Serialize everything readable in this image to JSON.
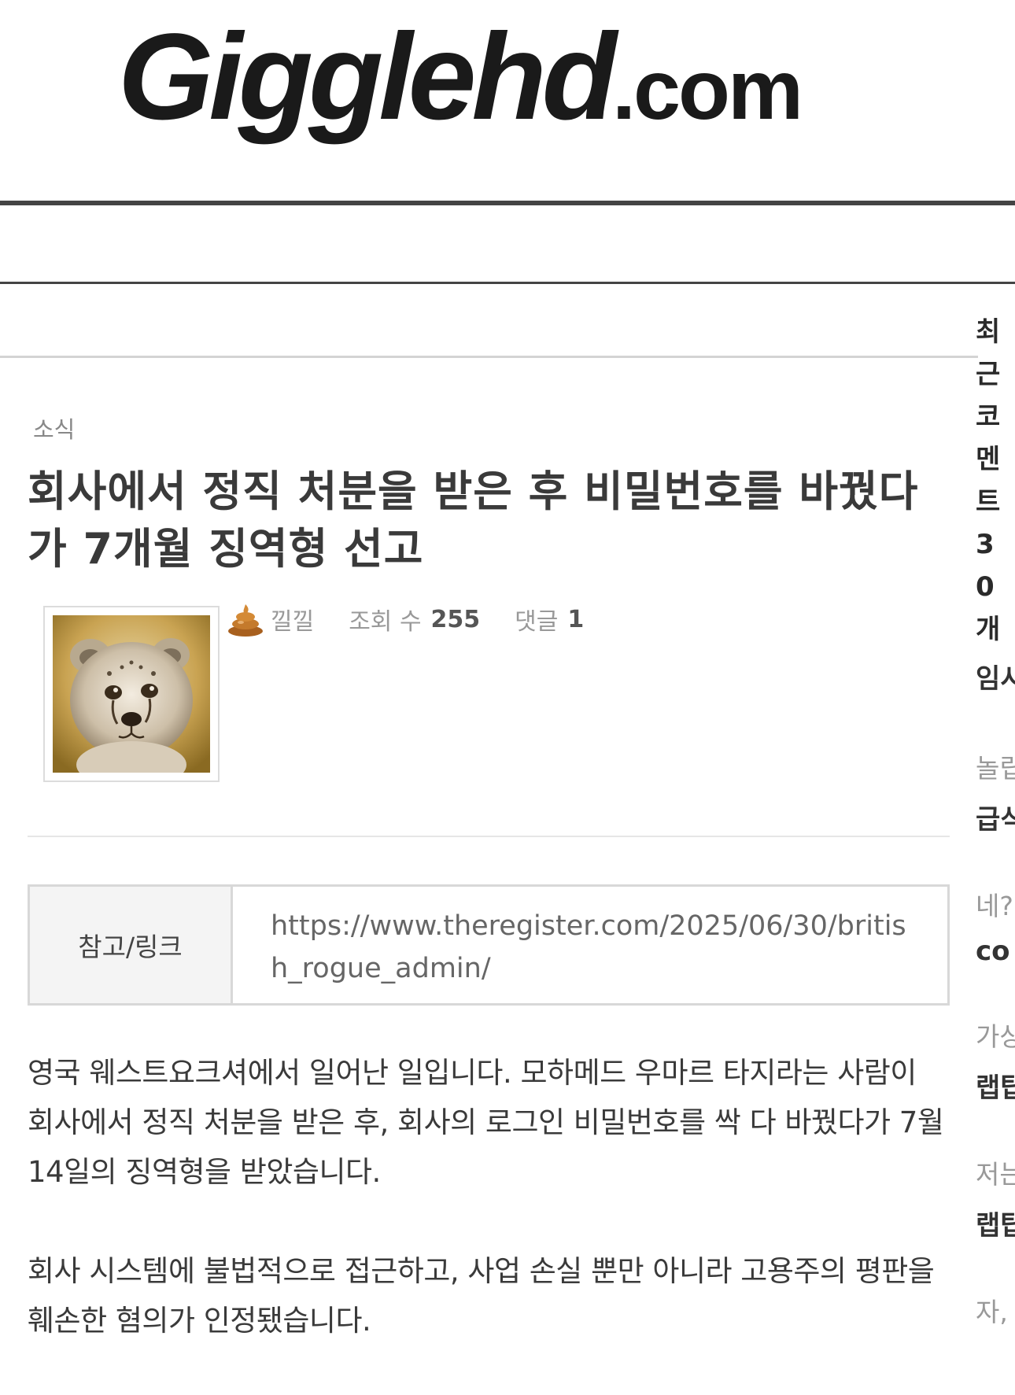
{
  "site": {
    "logo_main": "Gigglehd",
    "logo_tld": ".com"
  },
  "post": {
    "category": "소식",
    "title": "회사에서 정직 처분을 받은 후 비밀번호를 바꿨다가 7개월 징역형 선고",
    "author": "낄낄",
    "views_label": "조회 수",
    "views_value": "255",
    "comments_label": "댓글",
    "comments_value": "1",
    "ref_label": "참고/링크",
    "ref_url": "https://www.theregister.com/2025/06/30/british_rogue_admin/",
    "body": [
      "영국 웨스트요크셔에서 일어난 일입니다. 모하메드 우마르 타지라는 사람이 회사에서 정직 처분을 받은 후, 회사의 로그인 비밀번호를 싹 다 바꿨다가 7월 14일의 징역형을 받았습니다.",
      "회사 시스템에 불법적으로 접근하고, 사업 손실 뿐만 아니라 고용주의 평판을 훼손한 혐의가 인정됐습니다."
    ]
  },
  "sidebar": {
    "heading": "최근코멘트30개",
    "entries": [
      {
        "label": "",
        "title": "임시"
      },
      {
        "label": "놀립",
        "title": "급식"
      },
      {
        "label": "네?",
        "title": "co"
      },
      {
        "label": "가상",
        "title": "랩탑"
      },
      {
        "label": "저는",
        "title": "랩탑"
      },
      {
        "label": "자,",
        "title": ""
      }
    ]
  },
  "icons": {
    "author_badge": "poop-icon",
    "avatar": "cheetah-cub-avatar"
  }
}
